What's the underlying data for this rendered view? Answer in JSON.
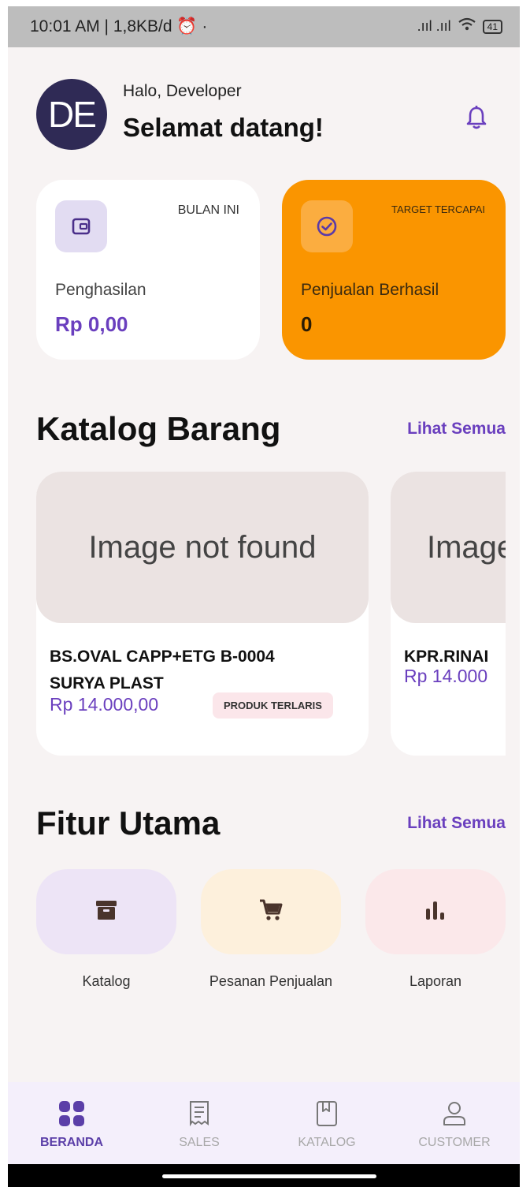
{
  "status_bar": {
    "time_info": "10:01 AM | 1,8KB/d ⏰ ·",
    "signal": ".ııl .ııl",
    "battery": "41"
  },
  "header": {
    "avatar_initials": "DE",
    "greeting": "Halo, Developer",
    "welcome": "Selamat datang!"
  },
  "stats": {
    "income": {
      "tag": "BULAN INI",
      "label": "Penghasilan",
      "value": "Rp 0,00"
    },
    "sales": {
      "tag": "TARGET TERCAPAI",
      "label": "Penjualan Berhasil",
      "value": "0"
    }
  },
  "catalog": {
    "title": "Katalog Barang",
    "see_all": "Lihat Semua",
    "products": [
      {
        "image_placeholder": "Image not found",
        "name_line1": "BS.OVAL CAPP+ETG B-0004",
        "name_line2": "SURYA PLAST",
        "price": "Rp 14.000,00",
        "badge": "PRODUK TERLARIS"
      },
      {
        "image_placeholder": "Image",
        "name_line1": "KPR.RINAI",
        "price": "Rp 14.000"
      }
    ]
  },
  "features": {
    "title": "Fitur Utama",
    "see_all": "Lihat Semua",
    "items": [
      {
        "label": "Katalog",
        "icon": "archive-box-icon",
        "bg": "#ede4f6"
      },
      {
        "label": "Pesanan Penjualan",
        "icon": "cart-icon",
        "bg": "#fdf0dc"
      },
      {
        "label": "Laporan",
        "icon": "bar-chart-icon",
        "bg": "#fbe8ea"
      }
    ]
  },
  "bottom_nav": [
    {
      "label": "BERANDA",
      "icon": "grid-icon",
      "active": true
    },
    {
      "label": "SALES",
      "icon": "receipt-icon",
      "active": false
    },
    {
      "label": "KATALOG",
      "icon": "book-icon",
      "active": false
    },
    {
      "label": "CUSTOMER",
      "icon": "person-icon",
      "active": false
    }
  ],
  "colors": {
    "accent": "#6a3fbe",
    "orange_card": "#fa9500",
    "avatar_bg": "#2f2a55",
    "background": "#f7f3f3"
  }
}
